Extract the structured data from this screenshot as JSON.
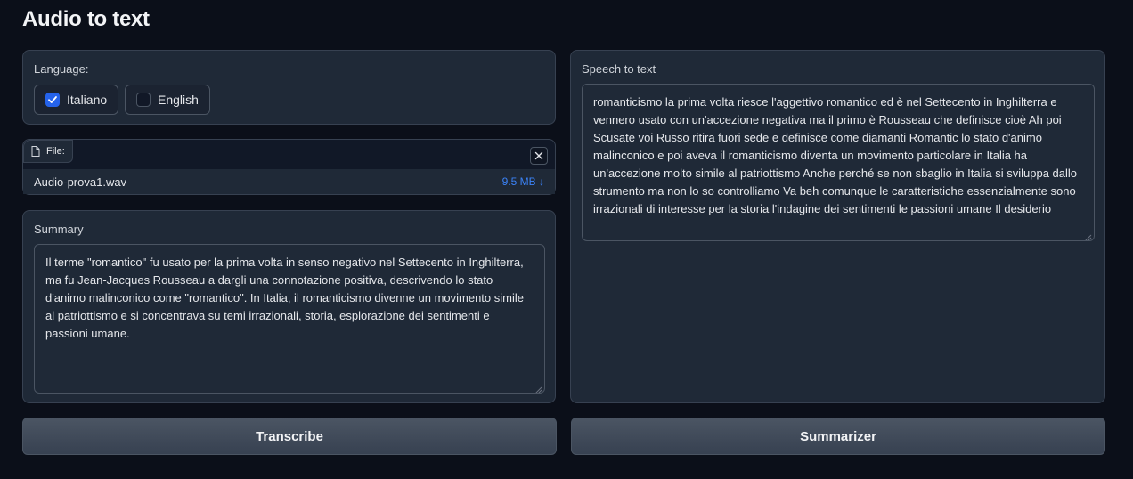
{
  "app": {
    "title": "Audio to text"
  },
  "language": {
    "label": "Language:",
    "options": [
      {
        "label": "Italiano",
        "checked": true
      },
      {
        "label": "English",
        "checked": false
      }
    ]
  },
  "file": {
    "chip_label": "File:",
    "name": "Audio-prova1.wav",
    "size": "9.5 MB ↓"
  },
  "summary": {
    "label": "Summary",
    "text": "Il terme \"romantico\" fu usato per la prima volta in senso negativo nel Settecento in Inghilterra, ma fu Jean-Jacques Rousseau a dargli una connotazione positiva, descrivendo lo stato d'animo malinconico come \"romantico\". In Italia, il romanticismo divenne un movimento simile al patriottismo e si concentrava su temi irrazionali, storia, esplorazione dei sentimenti e passioni umane."
  },
  "speech": {
    "label": "Speech to text",
    "text": "romanticismo la prima volta riesce l'aggettivo romantico ed è nel Settecento in Inghilterra e vennero usato con un'accezione negativa ma il primo è Rousseau che definisce cioè Ah poi Scusate voi Russo ritira fuori sede e definisce come diamanti Romantic lo stato d'animo malinconico e poi aveva il romanticismo diventa un movimento particolare in Italia ha un'accezione molto simile al patriottismo Anche perché se non sbaglio in Italia si sviluppa dallo strumento ma non lo so controlliamo Va beh comunque le caratteristiche essenzialmente sono irrazionali di interesse per la storia l'indagine dei sentimenti le passioni umane Il desiderio"
  },
  "buttons": {
    "transcribe": "Transcribe",
    "summarizer": "Summarizer"
  },
  "colors": {
    "background": "#0b0f19",
    "panel": "#1f2937",
    "accent": "#2563eb",
    "file_size": "#3b82f6"
  }
}
